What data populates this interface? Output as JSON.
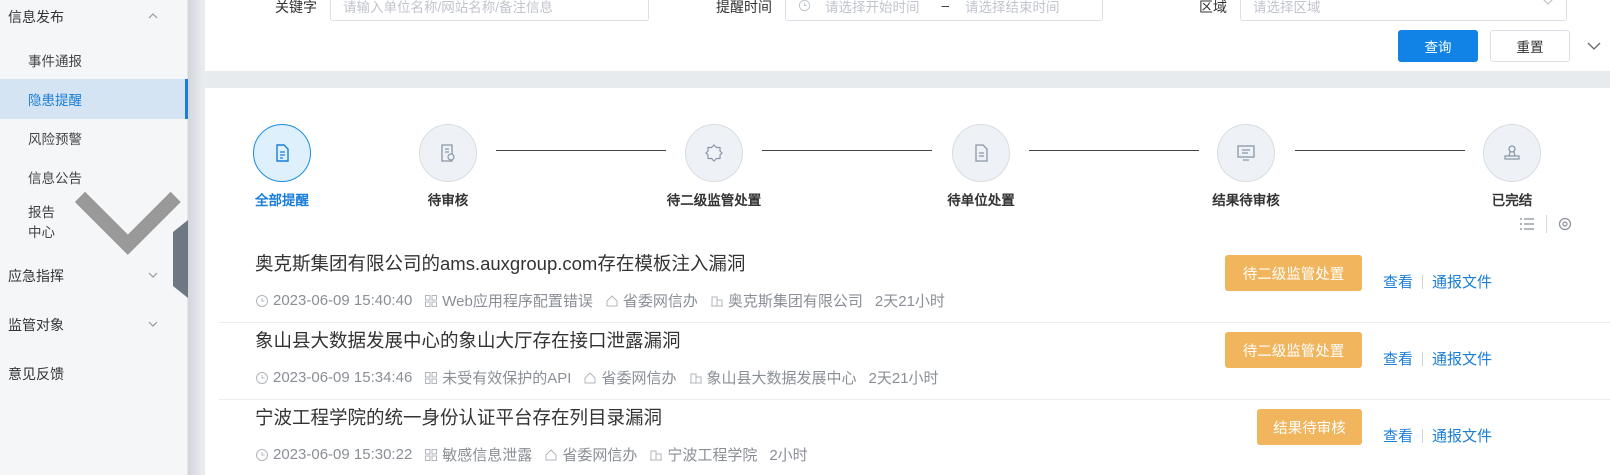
{
  "sidebar": {
    "groups": [
      {
        "label": "信息发布"
      },
      {
        "label": "应急指挥"
      },
      {
        "label": "监管对象"
      },
      {
        "label": "意见反馈"
      }
    ],
    "items": [
      {
        "label": "事件通报"
      },
      {
        "label": "隐患提醒"
      },
      {
        "label": "风险预警"
      },
      {
        "label": "信息公告"
      },
      {
        "label": "报告中心"
      }
    ]
  },
  "filters": {
    "keyword_label": "关键字",
    "keyword_placeholder": "请输入单位名称/网站名称/备注信息",
    "time_label": "提醒时间",
    "time_start_placeholder": "请选择开始时间",
    "time_sep": "–",
    "time_end_placeholder": "请选择结束时间",
    "region_label": "区域",
    "region_placeholder": "请选择区域",
    "query_button": "查询",
    "reset_button": "重置"
  },
  "steps": [
    {
      "label": "全部提醒",
      "icon": "document-icon",
      "active": true
    },
    {
      "label": "待审核",
      "icon": "review-icon",
      "active": false
    },
    {
      "label": "待二级监管处置",
      "icon": "badge-icon",
      "active": false
    },
    {
      "label": "待单位处置",
      "icon": "file-icon",
      "active": false
    },
    {
      "label": "结果待审核",
      "icon": "monitor-icon",
      "active": false
    },
    {
      "label": "已完结",
      "icon": "stamp-icon",
      "active": false
    }
  ],
  "records": [
    {
      "title": "奥克斯集团有限公司的ams.auxgroup.com存在模板注入漏洞",
      "time": "2023-06-09 15:40:40",
      "category": "Web应用程序配置错误",
      "dept": "省委网信办",
      "unit": "奥克斯集团有限公司",
      "elapsed": "2天21小时",
      "status": "待二级监管处置"
    },
    {
      "title": "象山县大数据发展中心的象山大厅存在接口泄露漏洞",
      "time": "2023-06-09 15:34:46",
      "category": "未受有效保护的API",
      "dept": "省委网信办",
      "unit": "象山县大数据发展中心",
      "elapsed": "2天21小时",
      "status": "待二级监管处置"
    },
    {
      "title": "宁波工程学院的统一身份认证平台存在列目录漏洞",
      "time": "2023-06-09 15:30:22",
      "category": "敏感信息泄露",
      "dept": "省委网信办",
      "unit": "宁波工程学院",
      "elapsed": "2小时",
      "status": "结果待审核"
    }
  ],
  "actions": {
    "view": "查看",
    "notice_file": "通报文件"
  },
  "colors": {
    "primary": "#1182e6",
    "status_tag": "#f0b55d",
    "active_nav_bg": "#d5e4f2"
  }
}
